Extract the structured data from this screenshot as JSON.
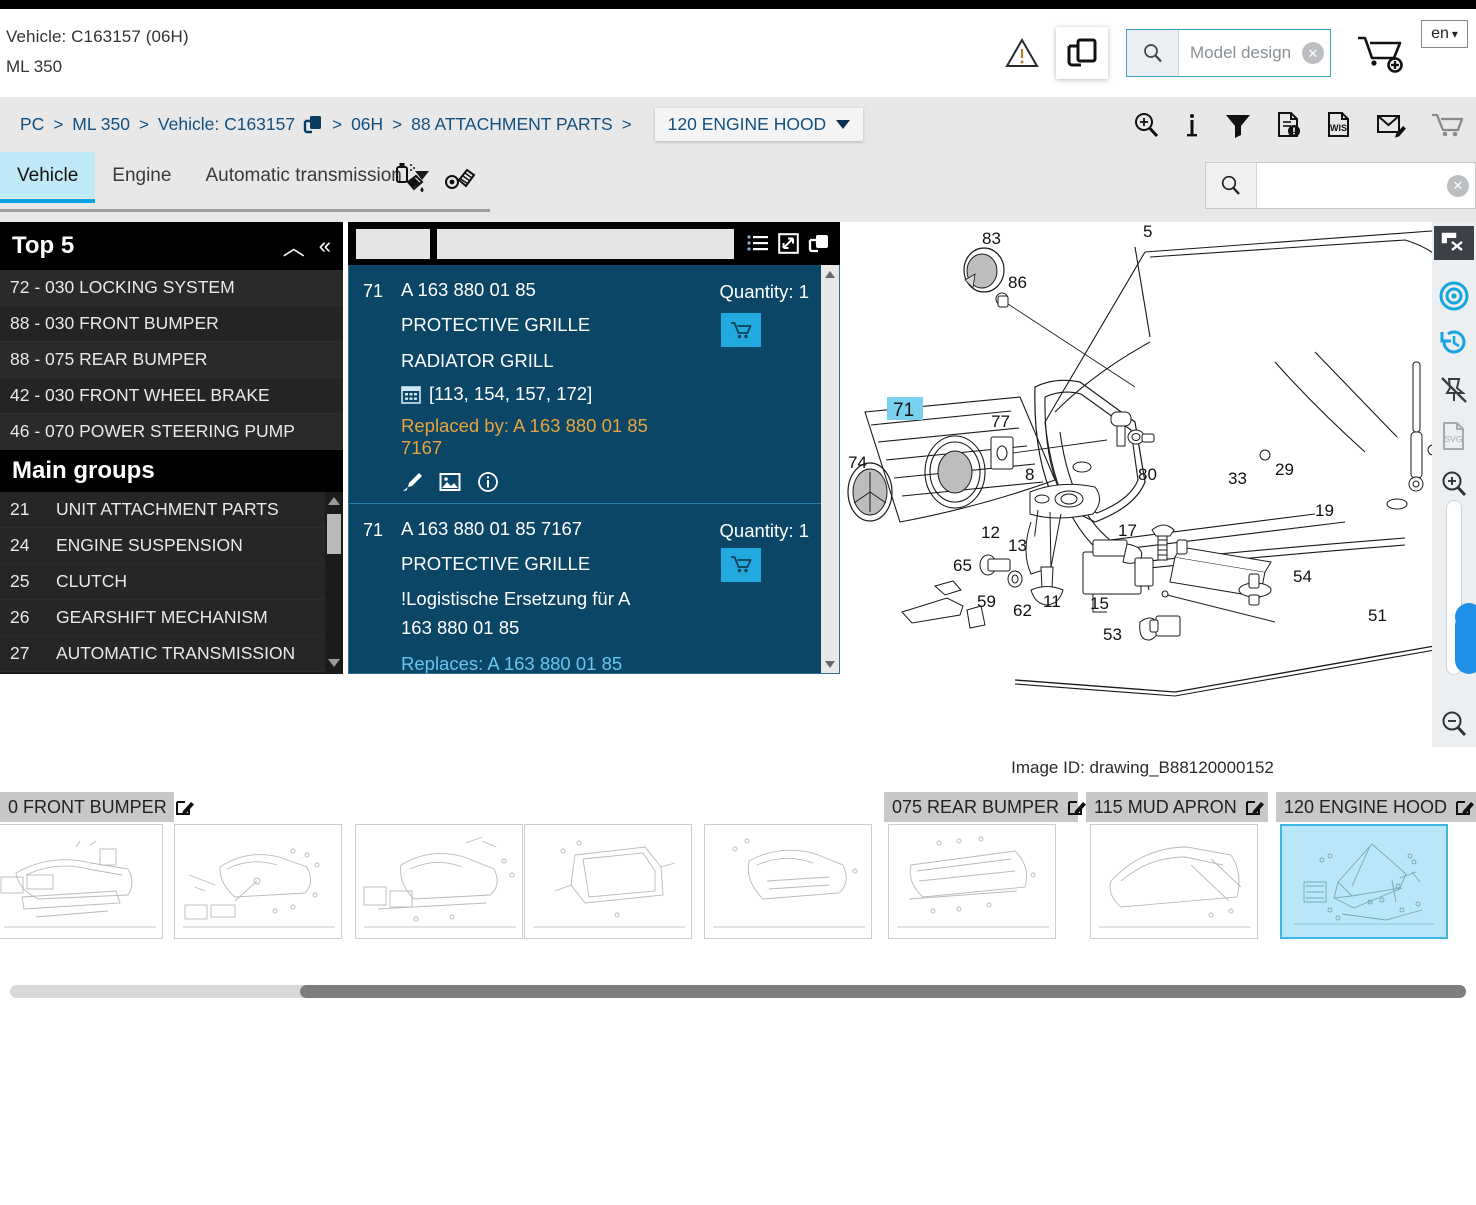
{
  "header": {
    "vehicle_title": "Vehicle: C163157 (06H)",
    "vehicle_model": "ML 350",
    "search_placeholder": "Model design",
    "language": "en",
    "icons": [
      "warning-icon",
      "copy-icon",
      "search-icon",
      "add-to-cart-icon"
    ]
  },
  "breadcrumb": {
    "items": [
      {
        "label": "PC"
      },
      {
        "label": "ML 350"
      },
      {
        "label": "Vehicle: C163157"
      },
      {
        "label": "06H"
      },
      {
        "label": "88 ATTACHMENT PARTS"
      }
    ],
    "separator": ">",
    "current": "120 ENGINE HOOD",
    "tools": [
      "zoom-in-icon",
      "info-icon",
      "filter-icon",
      "document-alert-icon",
      "wis-document-icon",
      "mail-edit-icon",
      "cart-icon"
    ]
  },
  "tabs": {
    "items": [
      {
        "label": "Vehicle",
        "active": true
      },
      {
        "label": "Engine",
        "active": false
      },
      {
        "label": "Automatic transmission",
        "active": false,
        "dropdown": true
      }
    ],
    "icons": [
      "paint-spray-icon",
      "fastener-icon"
    ],
    "search_value": ""
  },
  "sidebar": {
    "top5": {
      "title": "Top 5",
      "items": [
        {
          "label": "72 - 030 LOCKING SYSTEM"
        },
        {
          "label": "88 - 030 FRONT BUMPER"
        },
        {
          "label": "88 - 075 REAR BUMPER"
        },
        {
          "label": "42 - 030 FRONT WHEEL BRAKE"
        },
        {
          "label": "46 - 070 POWER STEERING PUMP"
        }
      ]
    },
    "main_groups": {
      "title": "Main groups",
      "items": [
        {
          "num": "21",
          "name": "UNIT ATTACHMENT PARTS"
        },
        {
          "num": "24",
          "name": "ENGINE SUSPENSION"
        },
        {
          "num": "25",
          "name": "CLUTCH"
        },
        {
          "num": "26",
          "name": "GEARSHIFT MECHANISM"
        },
        {
          "num": "27",
          "name": "AUTOMATIC TRANSMISSION"
        }
      ]
    }
  },
  "parts": {
    "toolbar_icons": [
      "list-view-icon",
      "expand-icon",
      "copy-icon"
    ],
    "rows": [
      {
        "index": "71",
        "part_number": "A 163 880 01 85",
        "description": "PROTECTIVE GRILLE",
        "subdescription": "RADIATOR GRILL",
        "codes": "[113, 154, 157, 172]",
        "replaced_by": "Replaced by: A 163 880 01 85 7167",
        "quantity_label": "Quantity: 1",
        "actions": [
          "brush-icon",
          "image-icon",
          "info-circle-icon"
        ]
      },
      {
        "index": "71",
        "part_number": "A 163 880 01 85 7167",
        "description": "PROTECTIVE GRILLE",
        "note": "!Logistische Ersetzung für A 163 880 01 85",
        "replaces": "Replaces: A 163 880 01 85",
        "quantity_label": "Quantity: 1"
      }
    ]
  },
  "drawing": {
    "image_id": "Image ID: drawing_B88120000152",
    "highlighted_callout": "71",
    "callouts": [
      "5",
      "83",
      "86",
      "71",
      "74",
      "77",
      "8",
      "80",
      "12",
      "13",
      "17",
      "29",
      "33",
      "19",
      "65",
      "59",
      "62",
      "11",
      "15",
      "53",
      "54",
      "51"
    ]
  },
  "viewer_tools": {
    "icons": [
      "close-window-icon",
      "target-icon",
      "history-icon",
      "unpin-icon",
      "svg-icon",
      "zoom-in-icon",
      "zoom-slider",
      "zoom-out-icon"
    ]
  },
  "thumbnails": {
    "groups": [
      {
        "label": "0 FRONT BUMPER",
        "selected": false
      },
      {
        "label": "075 REAR BUMPER",
        "selected": false
      },
      {
        "label": "115 MUD APRON",
        "selected": false
      },
      {
        "label": "120 ENGINE HOOD",
        "selected": true
      }
    ],
    "edit_icon": "edit-icon"
  }
}
